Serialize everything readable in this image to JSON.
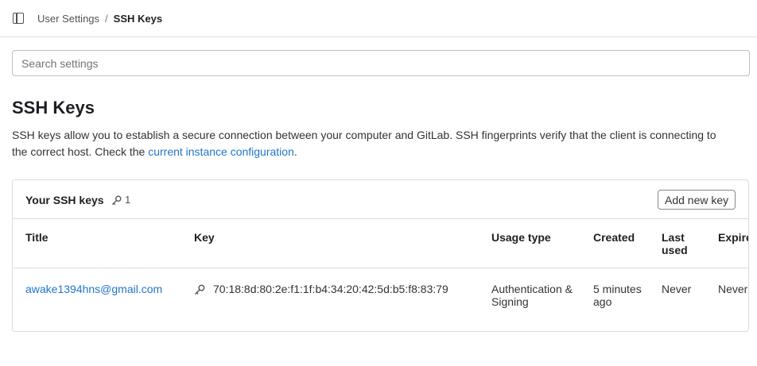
{
  "breadcrumb": {
    "parent": "User Settings",
    "separator": "/",
    "current": "SSH Keys"
  },
  "search": {
    "placeholder": "Search settings",
    "value": ""
  },
  "page": {
    "title": "SSH Keys",
    "description": "SSH keys allow you to establish a secure connection between your computer and GitLab. SSH fingerprints verify that the client is connecting to the correct host. Check the ",
    "link": "current instance configuration",
    "after_link": "."
  },
  "card": {
    "title": "Your SSH keys",
    "count": "1",
    "add_button": "Add new key"
  },
  "table": {
    "headers": {
      "title": "Title",
      "key": "Key",
      "usage": "Usage type",
      "created": "Created",
      "last_used": "Last used",
      "expires": "Expires"
    },
    "rows": [
      {
        "title": "awake1394hns@gmail.com",
        "key": "70:18:8d:80:2e:f1:1f:b4:34:20:42:5d:b5:f8:83:79",
        "usage": "Authentication & Signing",
        "created": "5 minutes ago",
        "last_used": "Never",
        "expires": "Never"
      }
    ]
  },
  "icons": {
    "sidebar_toggle": "sidebar-icon",
    "key": "key-icon"
  },
  "colors": {
    "link": "#1f75cb",
    "border": "#dcdcde",
    "text": "#333238"
  }
}
